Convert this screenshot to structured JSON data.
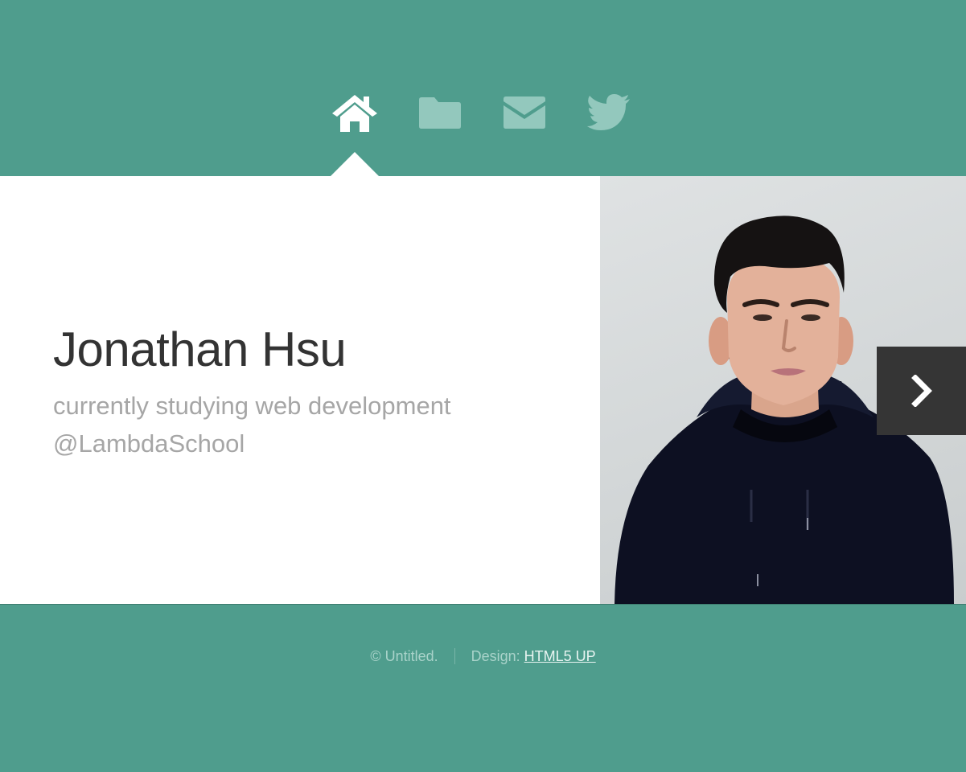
{
  "nav": {
    "items": [
      {
        "icon": "home-icon",
        "active": true
      },
      {
        "icon": "folder-icon",
        "active": false
      },
      {
        "icon": "envelope-icon",
        "active": false
      },
      {
        "icon": "twitter-icon",
        "active": false
      }
    ]
  },
  "intro": {
    "name": "Jonathan Hsu",
    "tagline_line1": "currently studying web development",
    "tagline_line2": "@LambdaSchool"
  },
  "photo": {
    "icon": "profile-photo"
  },
  "next_button": {
    "icon": "chevron-right-icon"
  },
  "footer": {
    "copyright": "© Untitled.",
    "design_label": "Design: ",
    "design_link": "HTML5 UP"
  },
  "colors": {
    "background": "#4f9d8d",
    "panel": "#ffffff",
    "name_text": "#333333",
    "tagline_text": "#a6a6a6",
    "next_button": "#353535",
    "nav_active": "#ffffff",
    "nav_inactive": "#93c8bd"
  }
}
